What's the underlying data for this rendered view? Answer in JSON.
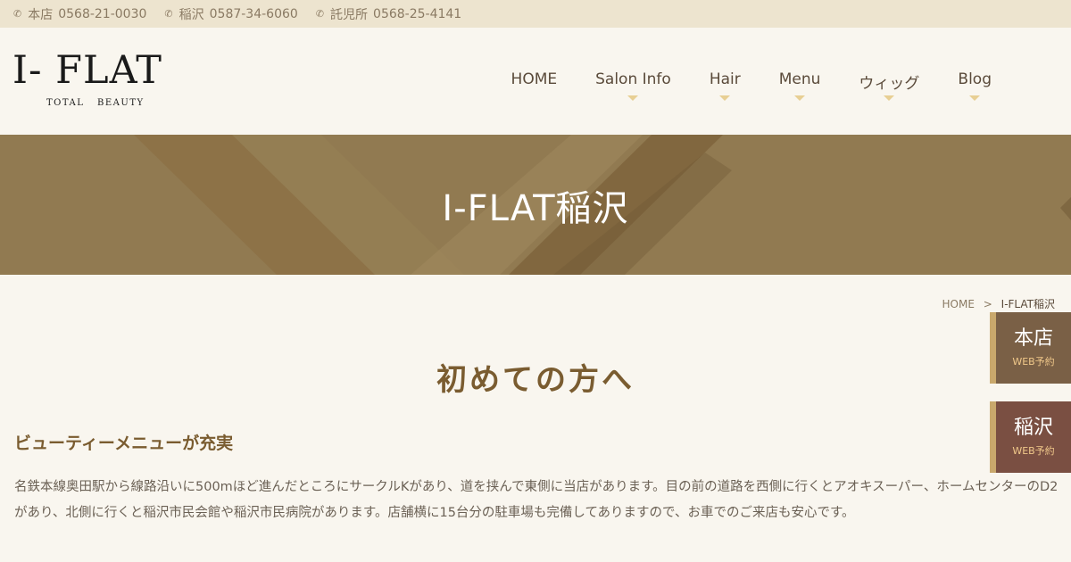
{
  "topbar": {
    "phones": [
      {
        "label": "本店",
        "number": "0568-21-0030"
      },
      {
        "label": "稲沢",
        "number": "0587-34-6060"
      },
      {
        "label": "託児所",
        "number": "0568-25-4141"
      }
    ]
  },
  "logo": {
    "main": "I- FLAT",
    "sub": "TOTAL BEAUTY"
  },
  "nav": {
    "items": [
      {
        "label": "HOME",
        "has_dropdown": false
      },
      {
        "label": "Salon Info",
        "has_dropdown": true
      },
      {
        "label": "Hair",
        "has_dropdown": true
      },
      {
        "label": "Menu",
        "has_dropdown": true
      },
      {
        "label": "ウィッグ",
        "has_dropdown": true
      },
      {
        "label": "Blog",
        "has_dropdown": true
      }
    ]
  },
  "hero": {
    "title": "I-FLAT稲沢"
  },
  "breadcrumb": {
    "home": "HOME",
    "separator": ">",
    "current": "I-FLAT稲沢"
  },
  "content": {
    "page_title": "初めての方へ",
    "section_title": "ビューティーメニューが充実",
    "body": "名鉄本線奥田駅から線路沿いに500mほど進んだところにサークルKがあり、道を挟んで東側に当店があります。目の前の道路を西側に行くとアオキスーパー、ホームセンターのD2があり、北側に行くと稲沢市民会館や稲沢市民病院があります。店舗横に15台分の駐車場も完備してありますので、お車でのご来店も安心です。"
  },
  "side_buttons": [
    {
      "name": "本店",
      "sub": "WEB予約"
    },
    {
      "name": "稲沢",
      "sub": "WEB予約"
    }
  ],
  "colors": {
    "topbar_bg": "#ede4cf",
    "hero_bg": "#917a51",
    "accent_brown": "#7a5c30",
    "dropdown_arrow": "#e8cf94",
    "side_main_bg": "#7a6046",
    "side_inazawa_bg": "#7a4f42"
  }
}
